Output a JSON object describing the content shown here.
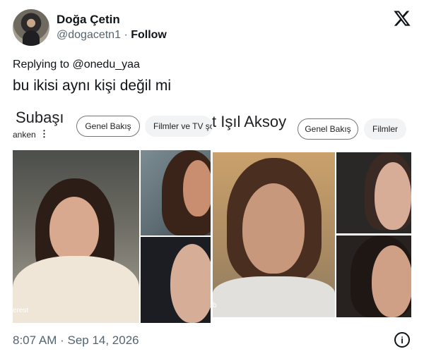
{
  "author": {
    "display_name": "Doğa Çetin",
    "handle": "@dogacetn1",
    "separator": "·",
    "follow_label": "Follow"
  },
  "header": {
    "logo_icon": "x-logo-icon"
  },
  "tweet": {
    "replying_to": "Replying to @onedu_yaa",
    "text": "bu ikisi aynı kişi değil mi"
  },
  "media": {
    "left_panel": {
      "title": "Subaşı",
      "subtitle": "anken",
      "more_icon": "more-vertical-icon",
      "chips": [
        "Genel Bakış",
        "Filmler ve TV şov"
      ],
      "watermark": "erest"
    },
    "right_panel": {
      "title": "t Işıl Aksoy",
      "chips": [
        "Genel Bakış",
        "Filmler"
      ],
      "watermark": "b"
    }
  },
  "footer": {
    "timestamp": "8:07 AM · Sep 14, 2026",
    "info_icon": "info-icon"
  }
}
